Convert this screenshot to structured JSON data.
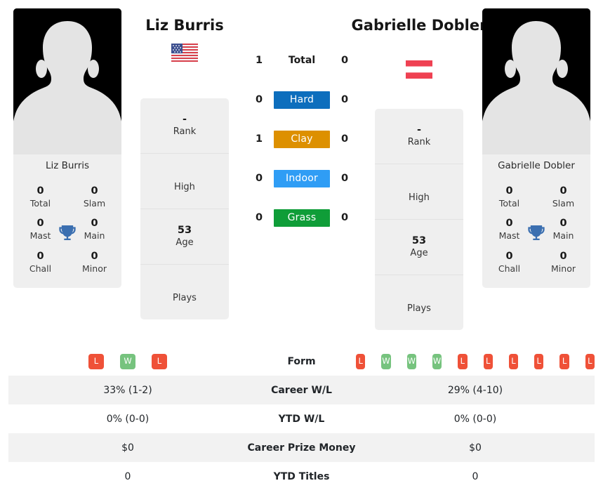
{
  "players": {
    "left": {
      "name": "Liz Burris",
      "photo_caption": "Liz Burris",
      "flag": "us-flag-icon",
      "titles": [
        {
          "value": "0",
          "label": "Total"
        },
        {
          "value": "0",
          "label": "Slam"
        },
        {
          "value": "0",
          "label": "Mast"
        },
        {
          "value": "0",
          "label": "Main"
        },
        {
          "value": "0",
          "label": "Chall"
        },
        {
          "value": "0",
          "label": "Minor"
        }
      ],
      "panels": [
        {
          "value": "-",
          "label": "Rank"
        },
        {
          "value": "",
          "label": "High"
        },
        {
          "value": "53",
          "label": "Age"
        },
        {
          "value": "",
          "label": "Plays"
        }
      ],
      "form": [
        "L",
        "W",
        "L"
      ]
    },
    "right": {
      "name": "Gabrielle Dobler",
      "photo_caption": "Gabrielle Dobler",
      "flag": "at-flag-icon",
      "titles": [
        {
          "value": "0",
          "label": "Total"
        },
        {
          "value": "0",
          "label": "Slam"
        },
        {
          "value": "0",
          "label": "Mast"
        },
        {
          "value": "0",
          "label": "Main"
        },
        {
          "value": "0",
          "label": "Chall"
        },
        {
          "value": "0",
          "label": "Minor"
        }
      ],
      "panels": [
        {
          "value": "-",
          "label": "Rank"
        },
        {
          "value": "",
          "label": "High"
        },
        {
          "value": "53",
          "label": "Age"
        },
        {
          "value": "",
          "label": "Plays"
        }
      ],
      "form": [
        "L",
        "W",
        "W",
        "W",
        "L",
        "L",
        "L",
        "L",
        "L",
        "L"
      ]
    }
  },
  "h2h": [
    {
      "label": "Total",
      "left": "1",
      "right": "0",
      "badge": false,
      "color": ""
    },
    {
      "label": "Hard",
      "left": "0",
      "right": "0",
      "badge": true,
      "color": "#0d6ebd"
    },
    {
      "label": "Clay",
      "left": "1",
      "right": "0",
      "badge": true,
      "color": "#dd9000"
    },
    {
      "label": "Indoor",
      "left": "0",
      "right": "0",
      "badge": true,
      "color": "#2f9df5"
    },
    {
      "label": "Grass",
      "left": "0",
      "right": "0",
      "badge": true,
      "color": "#0f9d38"
    }
  ],
  "comparison": {
    "form_label": "Form",
    "rows": [
      {
        "label": "Career W/L",
        "left": "33% (1-2)",
        "right": "29% (4-10)"
      },
      {
        "label": "YTD W/L",
        "left": "0% (0-0)",
        "right": "0% (0-0)"
      },
      {
        "label": "Career Prize Money",
        "left": "$0",
        "right": "$0"
      },
      {
        "label": "YTD Titles",
        "left": "0",
        "right": "0"
      }
    ]
  },
  "colors": {
    "win_badge": "#76c37e",
    "loss_badge": "#ef5138",
    "trophy": "#3b6fb0",
    "panel_bg": "#efefef",
    "row_alt": "#f2f2f2"
  }
}
